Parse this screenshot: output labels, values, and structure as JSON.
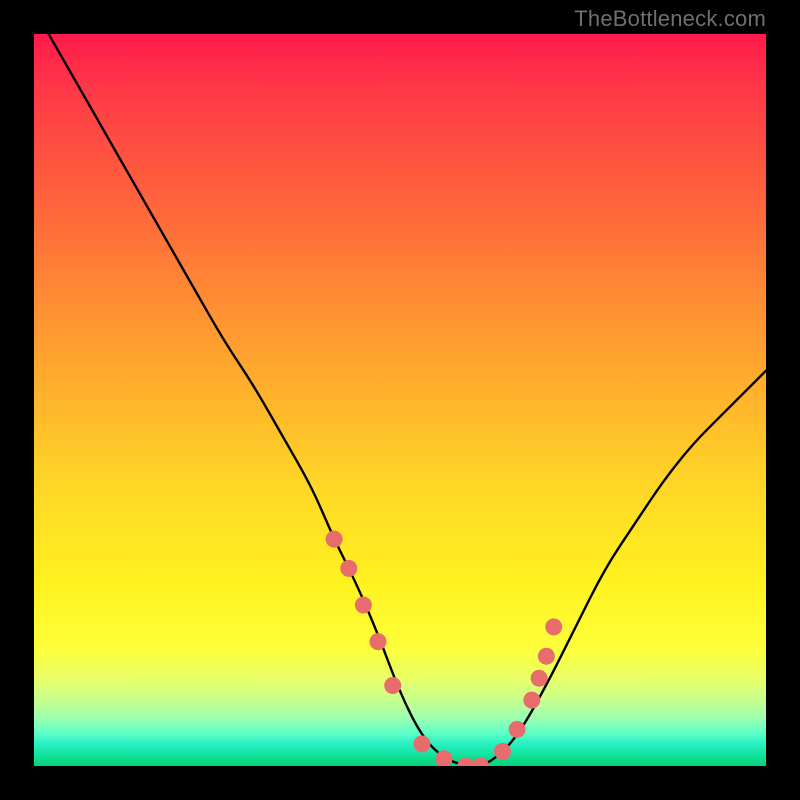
{
  "attribution": "TheBottleneck.com",
  "chart_data": {
    "type": "line",
    "title": "",
    "xlabel": "",
    "ylabel": "",
    "xlim": [
      0,
      100
    ],
    "ylim": [
      0,
      100
    ],
    "series": [
      {
        "name": "bottleneck-curve",
        "x": [
          2,
          6,
          10,
          14,
          18,
          22,
          26,
          30,
          34,
          38,
          41,
          44,
          47,
          50,
          53,
          56,
          59,
          61,
          63,
          66,
          70,
          74,
          78,
          82,
          86,
          90,
          94,
          98,
          100
        ],
        "values": [
          100,
          93,
          86,
          79,
          72,
          65,
          58,
          52,
          45,
          38,
          31,
          25,
          18,
          10,
          4,
          1,
          0,
          0,
          1,
          4,
          11,
          19,
          27,
          33,
          39,
          44,
          48,
          52,
          54
        ]
      }
    ],
    "markers": {
      "name": "highlight-dots",
      "color": "#e86c6c",
      "x": [
        41,
        43,
        45,
        47,
        49,
        53,
        56,
        59,
        61,
        64,
        66,
        68,
        69,
        70,
        71
      ],
      "values": [
        31,
        27,
        22,
        17,
        11,
        3,
        1,
        0,
        0,
        2,
        5,
        9,
        12,
        15,
        19
      ]
    }
  }
}
